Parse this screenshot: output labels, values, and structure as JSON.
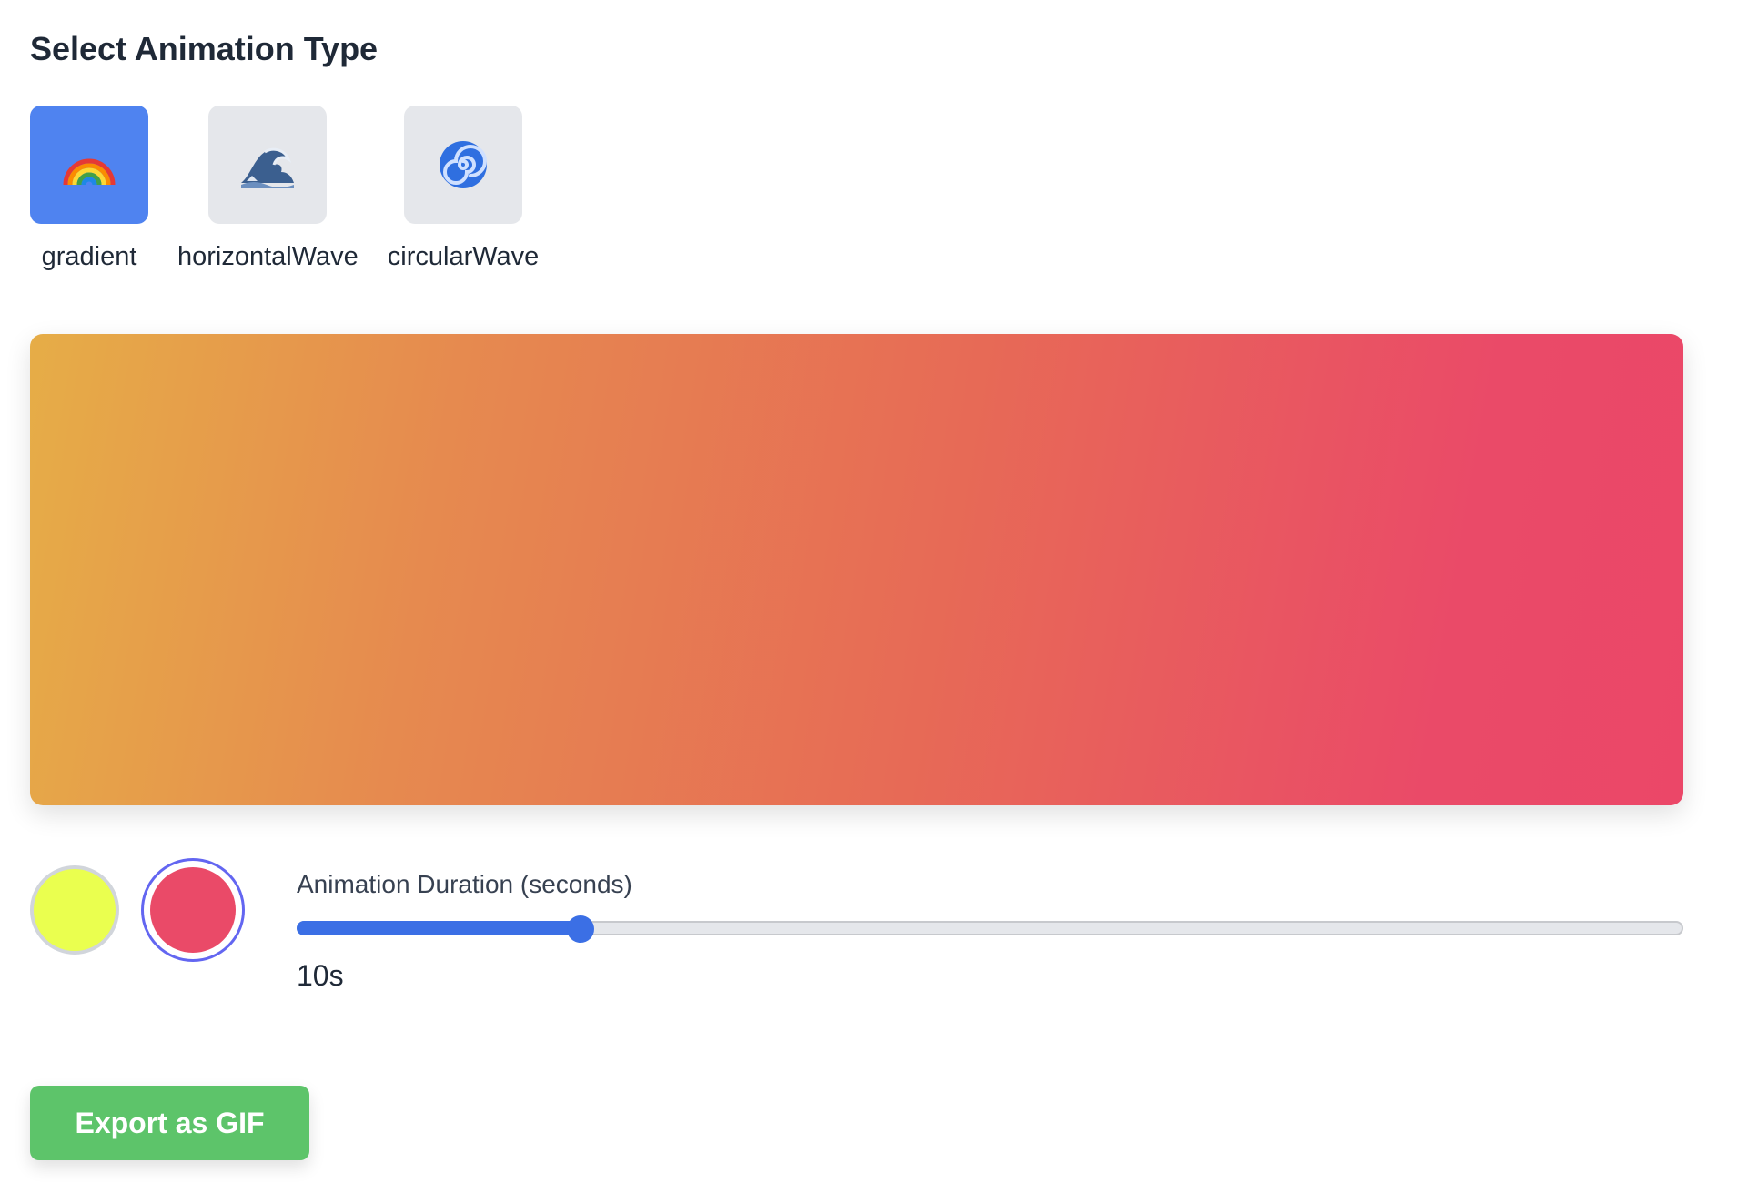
{
  "heading": "Select Animation Type",
  "animation_types": [
    {
      "label": "gradient",
      "icon": "rainbow-icon",
      "selected": true
    },
    {
      "label": "horizontalWave",
      "icon": "wave-icon",
      "selected": false
    },
    {
      "label": "circularWave",
      "icon": "spiral-icon",
      "selected": false
    }
  ],
  "preview": {
    "gradient_from": "#e6ad47",
    "gradient_to": "#eb4768"
  },
  "colors": {
    "swatch_1": "#eaff4f",
    "swatch_2": "#ea4a68",
    "selected_swatch": 2,
    "selected_ring": "#6366f1"
  },
  "duration": {
    "label": "Animation Duration (seconds)",
    "value_text": "10s",
    "value_fraction": 0.205,
    "accent": "#3b6fe5"
  },
  "export_button": {
    "label": "Export as GIF",
    "color": "#5dc46a"
  }
}
